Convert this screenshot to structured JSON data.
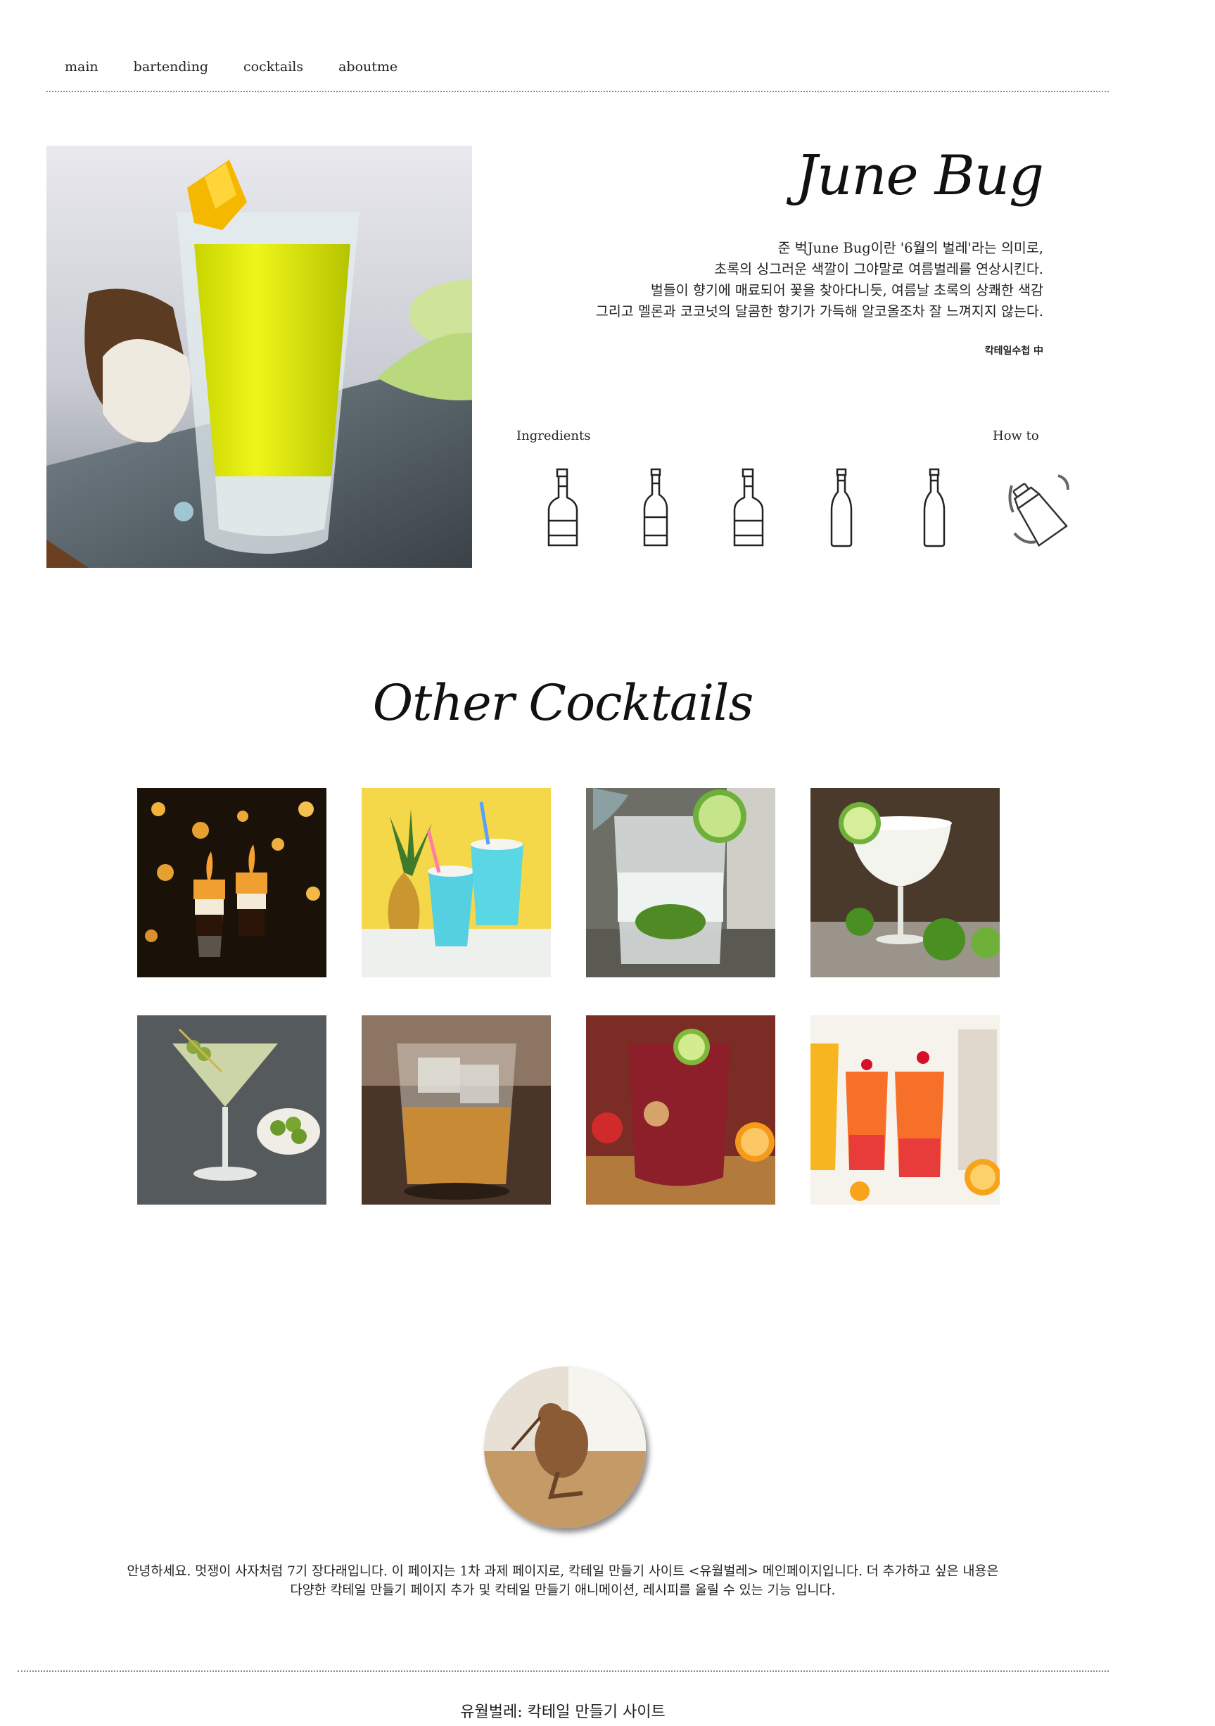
{
  "nav": {
    "items": [
      {
        "label": "main"
      },
      {
        "label": "bartending"
      },
      {
        "label": "cocktails"
      },
      {
        "label": "aboutme"
      }
    ]
  },
  "hero": {
    "title": "June Bug",
    "description": [
      "준 벅June Bug이란 '6월의 벌레'라는 의미로,",
      "초록의 싱그러운 색깔이 그야말로 여름벌레를 연상시킨다.",
      "벌들이 향기에 매료되어 꽃을 찾아다니듯, 여름날 초록의 상쾌한 색감",
      "그리고 멜론과 코코넛의 달콤한 향기가 가득해 알코올조차 잘 느껴지지 않는다."
    ],
    "source": "칵테일수첩 中",
    "ingredients_label": "Ingredients",
    "howto_label": "How to",
    "ingredient_icons": [
      "cognac-bottle-icon",
      "wine-bottle-icon",
      "cognac-bottle-icon",
      "slim-bottle-icon",
      "slim-bottle-icon"
    ],
    "howto_icon": "shaker-icon"
  },
  "other": {
    "title": "Other Cocktails"
  },
  "about": {
    "text": "안녕하세요. 멋쟁이 사자처럼 7기 장다래입니다. 이 페이지는 1차 과제 페이지로, 칵테일 만들기 사이트 <유월벌레> 메인페이지입니다. 더 추가하고 싶은 내용은 다양한 칵테일 만들기 페이지 추가 및 칵테일 만들기 애니메이션, 레시피를 올릴 수 있는 기능 입니다."
  },
  "footer": {
    "text": "유월벌레: 칵테일 만들기 사이트"
  }
}
